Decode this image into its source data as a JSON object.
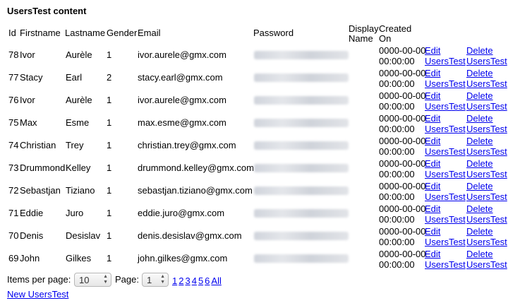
{
  "title": "UsersTest content",
  "columns": {
    "id": "Id",
    "firstname": "Firstname",
    "lastname": "Lastname",
    "gender": "Gender",
    "email": "Email",
    "password": "Password",
    "display_name_1": "Display",
    "display_name_2": "Name",
    "created_on_1": "Created",
    "created_on_2": "On"
  },
  "rows": [
    {
      "id": "78",
      "firstname": "Ivor",
      "lastname": "Aurèle",
      "gender": "1",
      "email": "ivor.aurele@gmx.com"
    },
    {
      "id": "77",
      "firstname": "Stacy",
      "lastname": "Earl",
      "gender": "2",
      "email": "stacy.earl@gmx.com"
    },
    {
      "id": "76",
      "firstname": "Ivor",
      "lastname": "Aurèle",
      "gender": "1",
      "email": "ivor.aurele@gmx.com"
    },
    {
      "id": "75",
      "firstname": "Max",
      "lastname": "Esme",
      "gender": "1",
      "email": "max.esme@gmx.com"
    },
    {
      "id": "74",
      "firstname": "Christian",
      "lastname": "Trey",
      "gender": "1",
      "email": "christian.trey@gmx.com"
    },
    {
      "id": "73",
      "firstname": "Drummond",
      "lastname": "Kelley",
      "gender": "1",
      "email": "drummond.kelley@gmx.com"
    },
    {
      "id": "72",
      "firstname": "Sebastjan",
      "lastname": "Tiziano",
      "gender": "1",
      "email": "sebastjan.tiziano@gmx.com"
    },
    {
      "id": "71",
      "firstname": "Eddie",
      "lastname": "Juro",
      "gender": "1",
      "email": "eddie.juro@gmx.com"
    },
    {
      "id": "70",
      "firstname": "Denis",
      "lastname": "Desislav",
      "gender": "1",
      "email": "denis.desislav@gmx.com"
    },
    {
      "id": "69",
      "firstname": "John",
      "lastname": "Gilkes",
      "gender": "1",
      "email": "john.gilkes@gmx.com"
    }
  ],
  "row_common": {
    "created_line1": "0000-00-00",
    "created_line2": "00:00:00",
    "edit_line1": "Edit",
    "edit_line2": "UsersTest",
    "delete_line1": "Delete",
    "delete_line2": "UsersTest"
  },
  "footer": {
    "items_per_page_label": "Items per page:",
    "items_per_page_value": "10",
    "page_label": "Page:",
    "page_value": "1",
    "pages": [
      "1",
      "2",
      "3",
      "4",
      "5",
      "6"
    ],
    "all_label": "All",
    "new_link": "New UsersTest"
  }
}
